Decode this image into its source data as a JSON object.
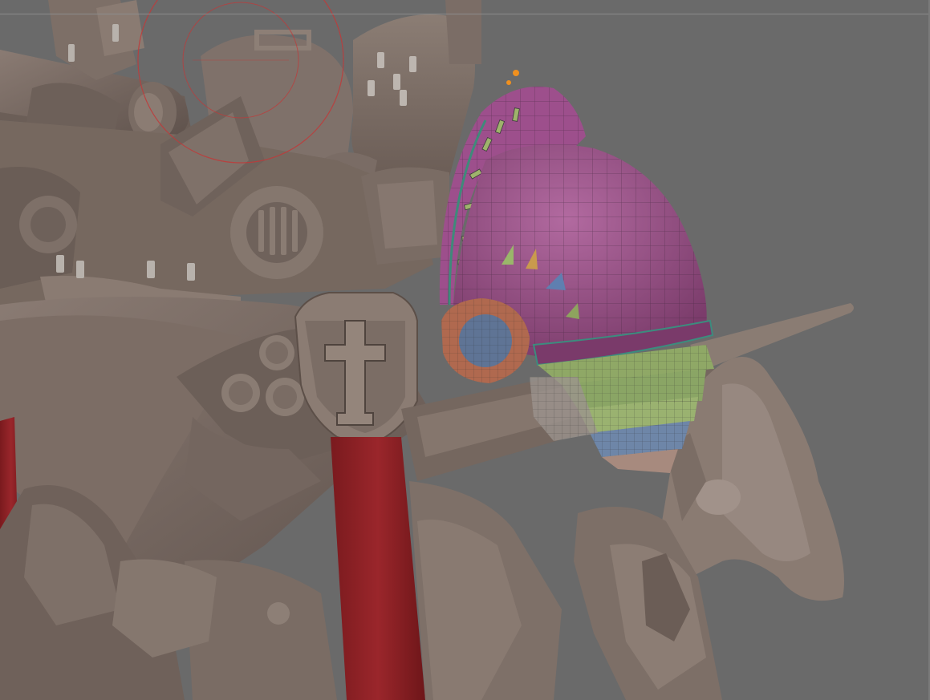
{
  "viewport": {
    "background_color": "#6a6a6a",
    "guide_line_color": "#8c8c8c",
    "brush_cursor_color": "#c03a3a"
  },
  "model": {
    "base_material_color": "#7d6e66",
    "cloth_strap_color": "#8d2226",
    "selected_subtool_color": "#a04f8e",
    "ring_color": "#b06a55",
    "lens_color": "#5f7495",
    "plate_green": "#8aa565",
    "plate_blue": "#6e86a8",
    "gizmo_color": "#f0901e"
  },
  "icons": [
    "brush-cursor-icon",
    "transpose-gizmo-icon"
  ]
}
